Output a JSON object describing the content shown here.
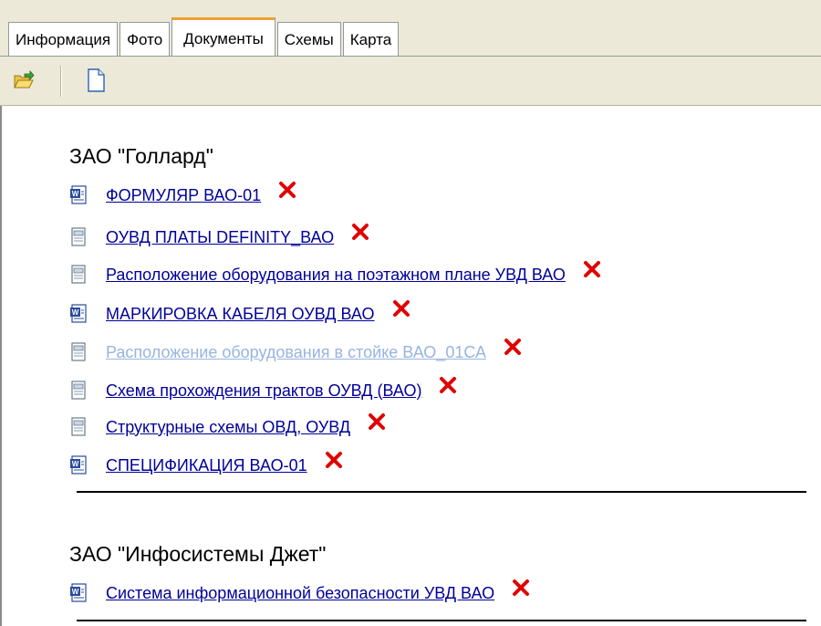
{
  "tabs": [
    {
      "label": "Информация",
      "active": false
    },
    {
      "label": "Фото",
      "active": false
    },
    {
      "label": "Документы",
      "active": true
    },
    {
      "label": "Схемы",
      "active": false
    },
    {
      "label": "Карта",
      "active": false
    }
  ],
  "toolbar": {
    "buttons": [
      {
        "icon": "open-folder-icon"
      },
      {
        "icon": "new-document-icon"
      }
    ]
  },
  "groups": [
    {
      "title": "ЗАО \"Голлард\"",
      "documents": [
        {
          "name": "ФОРМУЛЯР ВАО-01",
          "type": "word-doc-icon",
          "visited": false
        },
        {
          "name": "ОУВД ПЛАТЫ DEFINITY_ВАО",
          "type": "generic-doc-icon",
          "visited": false
        },
        {
          "name": "Расположение оборудования на поэтажном плане УВД ВАО",
          "type": "generic-doc-icon",
          "visited": false
        },
        {
          "name": "МАРКИРОВКА КАБЕЛЯ ОУВД ВАО",
          "type": "word-doc-icon",
          "visited": false
        },
        {
          "name": "Расположение оборудования в стойке ВАО_01СА",
          "type": "generic-doc-icon",
          "visited": true
        },
        {
          "name": "Схема прохождения трактов ОУВД (ВАО)",
          "type": "generic-doc-icon",
          "visited": false
        },
        {
          "name": "Структурные схемы ОВД, ОУВД",
          "type": "generic-doc-icon",
          "visited": false
        },
        {
          "name": "СПЕЦИФИКАЦИЯ ВАО-01",
          "type": "word-doc-icon",
          "visited": false
        }
      ]
    },
    {
      "title": "ЗАО \"Инфосистемы Джет\"",
      "documents": [
        {
          "name": "Система информационной безопасности УВД ВАО",
          "type": "word-doc-icon",
          "visited": false
        }
      ]
    }
  ],
  "colors": {
    "link": "#000099",
    "visited_link": "#98b4e0",
    "delete": "#e00000",
    "active_tab_accent": "#f0a030",
    "chrome_bg": "#ece9d8"
  }
}
